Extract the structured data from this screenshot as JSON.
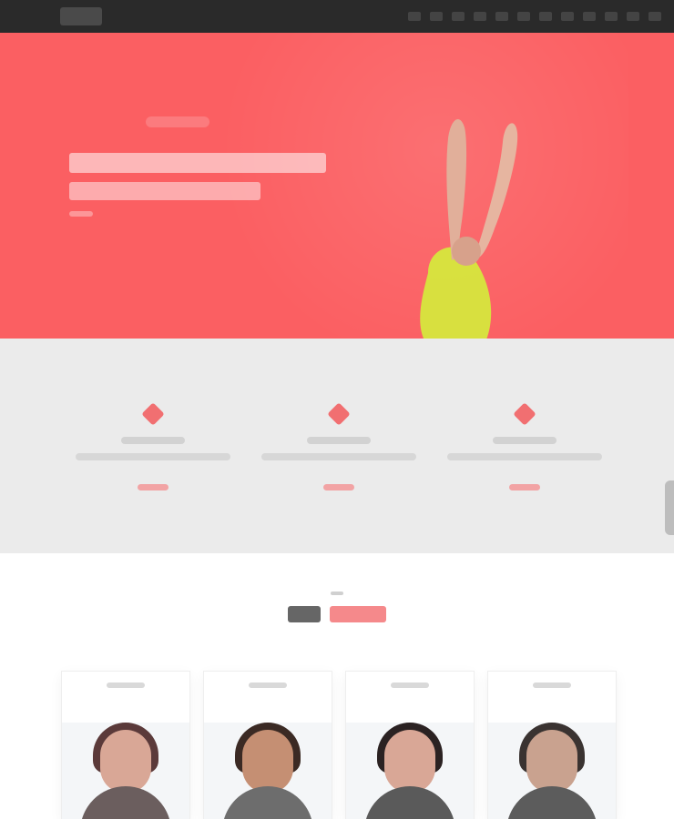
{
  "colors": {
    "topbar": "#2a2a2a",
    "hero": "#fb5f62",
    "accent": "#f26264",
    "features_bg": "#ebebeb",
    "page_bg": "#ffffff"
  },
  "icons": {
    "feature_icon": "diamond-icon"
  },
  "header": {
    "logo_text": "",
    "nav_items": [
      "",
      "",
      "",
      "",
      "",
      "",
      "",
      "",
      "",
      "",
      "",
      ""
    ]
  },
  "hero": {
    "kicker": "",
    "headline_1": "",
    "headline_2": "",
    "subtext": ""
  },
  "features": [
    {
      "title": "",
      "description": "",
      "more_label": ""
    },
    {
      "title": "",
      "description": "",
      "more_label": ""
    },
    {
      "title": "",
      "description": "",
      "more_label": ""
    }
  ],
  "team": {
    "small_label": "",
    "title_dark": "",
    "title_accent": "",
    "cards": [
      {
        "caption": ""
      },
      {
        "caption": ""
      },
      {
        "caption": ""
      },
      {
        "caption": ""
      }
    ]
  }
}
